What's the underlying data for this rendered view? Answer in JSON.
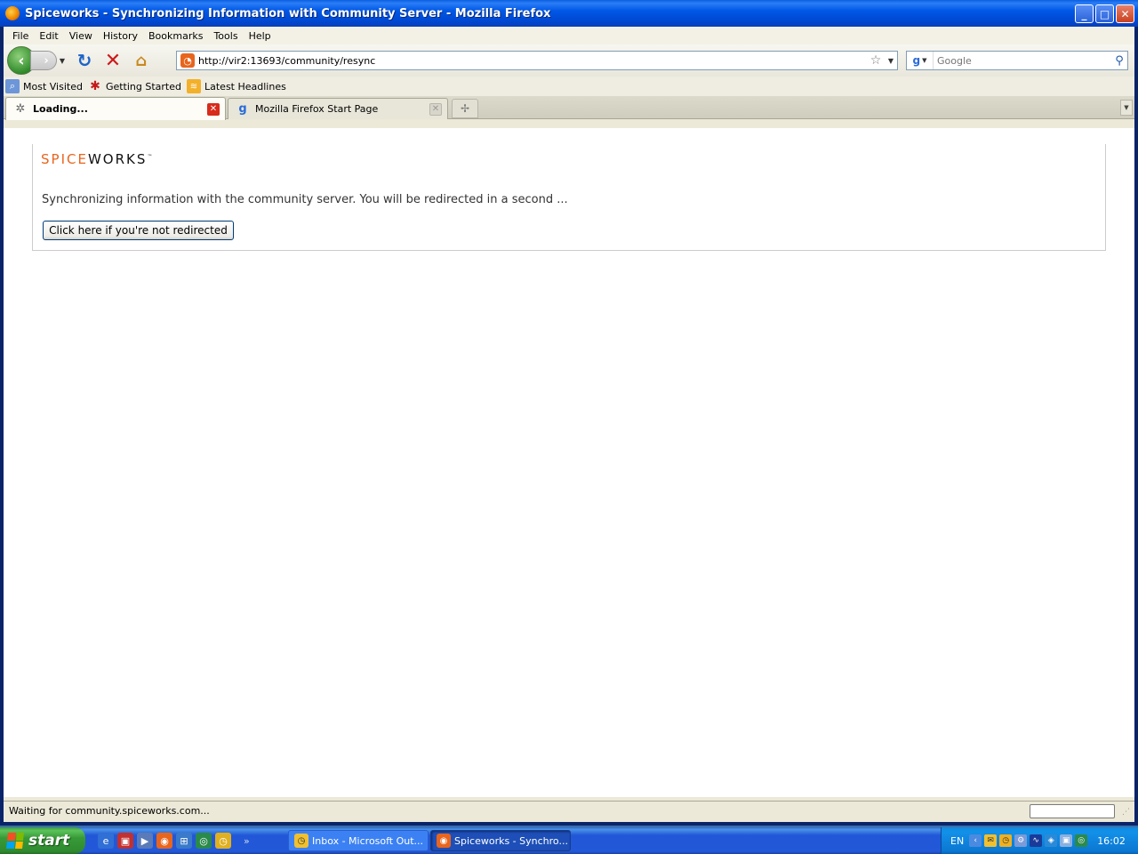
{
  "window": {
    "title": "Spiceworks - Synchronizing Information with Community Server - Mozilla Firefox",
    "controls": {
      "minimize": "_",
      "maximize": "□",
      "close": "✕"
    }
  },
  "menu": [
    "File",
    "Edit",
    "View",
    "History",
    "Bookmarks",
    "Tools",
    "Help"
  ],
  "nav": {
    "url": "http://vir2:13693/community/resync",
    "search_placeholder": "Google"
  },
  "bookmarks": [
    {
      "label": "Most Visited",
      "icon": "most-visited-icon"
    },
    {
      "label": "Getting Started",
      "icon": "getting-started-icon"
    },
    {
      "label": "Latest Headlines",
      "icon": "rss-icon"
    }
  ],
  "tabs": [
    {
      "label": "Loading...",
      "active": true,
      "icon": "loading-spinner-icon"
    },
    {
      "label": "Mozilla Firefox Start Page",
      "active": false,
      "icon": "google-icon"
    }
  ],
  "page": {
    "logo": {
      "spice": "SPICE",
      "works": "WORKS",
      "tm": "™"
    },
    "message": "Synchronizing information with the community server. You will be redirected in a second ...",
    "button_label": "Click here if you're not redirected"
  },
  "status": {
    "text": "Waiting for community.spiceworks.com..."
  },
  "taskbar": {
    "start_label": "start",
    "tasks": [
      {
        "label": "Inbox - Microsoft Out...",
        "icon": "outlook-icon"
      },
      {
        "label": "Spiceworks - Synchro...",
        "icon": "firefox-icon"
      }
    ],
    "tray": {
      "lang": "EN",
      "clock": "16:02"
    }
  },
  "colors": {
    "spice_orange": "#e8651e",
    "titlebar_blue": "#0058e6",
    "taskbar_blue": "#2359d8",
    "start_green": "#379a37"
  }
}
